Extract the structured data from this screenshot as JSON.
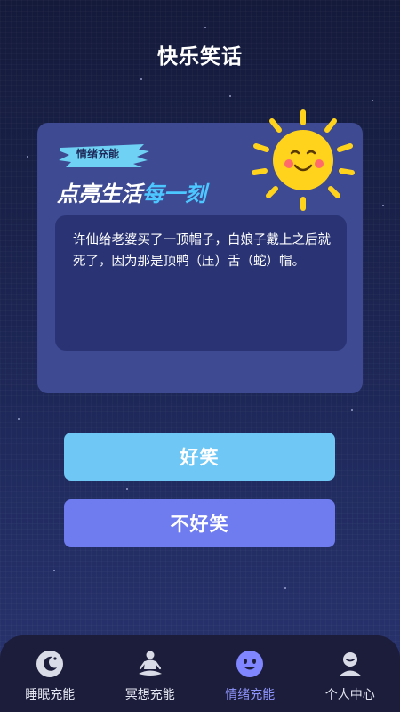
{
  "header": {
    "title": "快乐笑话"
  },
  "card": {
    "tag": "情绪充能",
    "headline_main": "点亮生活",
    "headline_highlight": "每一刻",
    "joke": "许仙给老婆买了一顶帽子，白娘子戴上之后就死了，因为那是顶鸭（压）舌（蛇）帽。"
  },
  "buttons": {
    "funny": "好笑",
    "not_funny": "不好笑"
  },
  "tabs": [
    {
      "label": "睡眠充能",
      "icon": "moon-icon",
      "active": false
    },
    {
      "label": "冥想充能",
      "icon": "meditation-icon",
      "active": false
    },
    {
      "label": "情绪充能",
      "icon": "smiley-icon",
      "active": true
    },
    {
      "label": "个人中心",
      "icon": "person-icon",
      "active": false
    }
  ],
  "colors": {
    "accent": "#6f7cf0",
    "highlight": "#4cc7ff",
    "sun": "#ffd21c"
  }
}
